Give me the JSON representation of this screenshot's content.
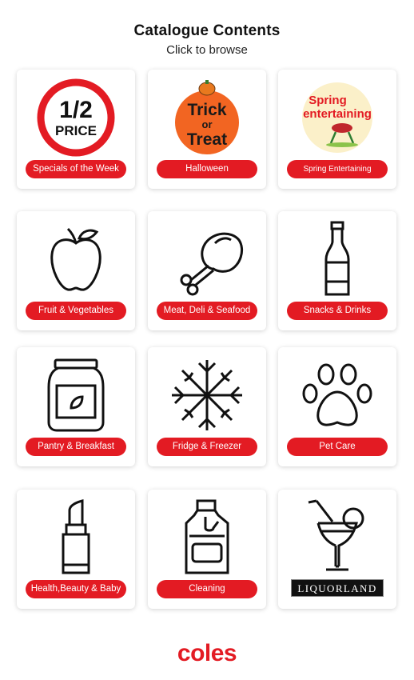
{
  "header": {
    "title": "Catalogue Contents",
    "subtitle": "Click to browse"
  },
  "tiles": [
    {
      "label": "Specials of the Week",
      "icon": "half-price-icon",
      "badge_top": "1/2",
      "badge_bottom": "PRICE"
    },
    {
      "label": "Halloween",
      "icon": "trick-or-treat-icon",
      "line1": "Trick",
      "line2": "or",
      "line3": "Treat"
    },
    {
      "label": "Spring Entertaining",
      "icon": "spring-entertaining-icon",
      "line1": "Spring",
      "line2": "entertaining"
    },
    {
      "label": "Fruit & Vegetables",
      "icon": "apple-icon"
    },
    {
      "label": "Meat, Deli & Seafood",
      "icon": "drumstick-icon"
    },
    {
      "label": "Snacks & Drinks",
      "icon": "bottle-icon"
    },
    {
      "label": "Pantry & Breakfast",
      "icon": "jar-icon"
    },
    {
      "label": "Fridge & Freezer",
      "icon": "snowflake-icon"
    },
    {
      "label": "Pet Care",
      "icon": "paw-icon"
    },
    {
      "label": "Health,Beauty & Baby",
      "icon": "lipstick-icon"
    },
    {
      "label": "Cleaning",
      "icon": "detergent-bottle-icon"
    },
    {
      "label": "LIQUORLAND",
      "icon": "cocktail-icon"
    }
  ],
  "footer": {
    "brand": "coles"
  },
  "colors": {
    "accent": "#e31b23",
    "tile_bg": "#ffffff",
    "text": "#111111",
    "halloween_orange": "#f26522",
    "spring_bg": "#fbf0c9"
  }
}
